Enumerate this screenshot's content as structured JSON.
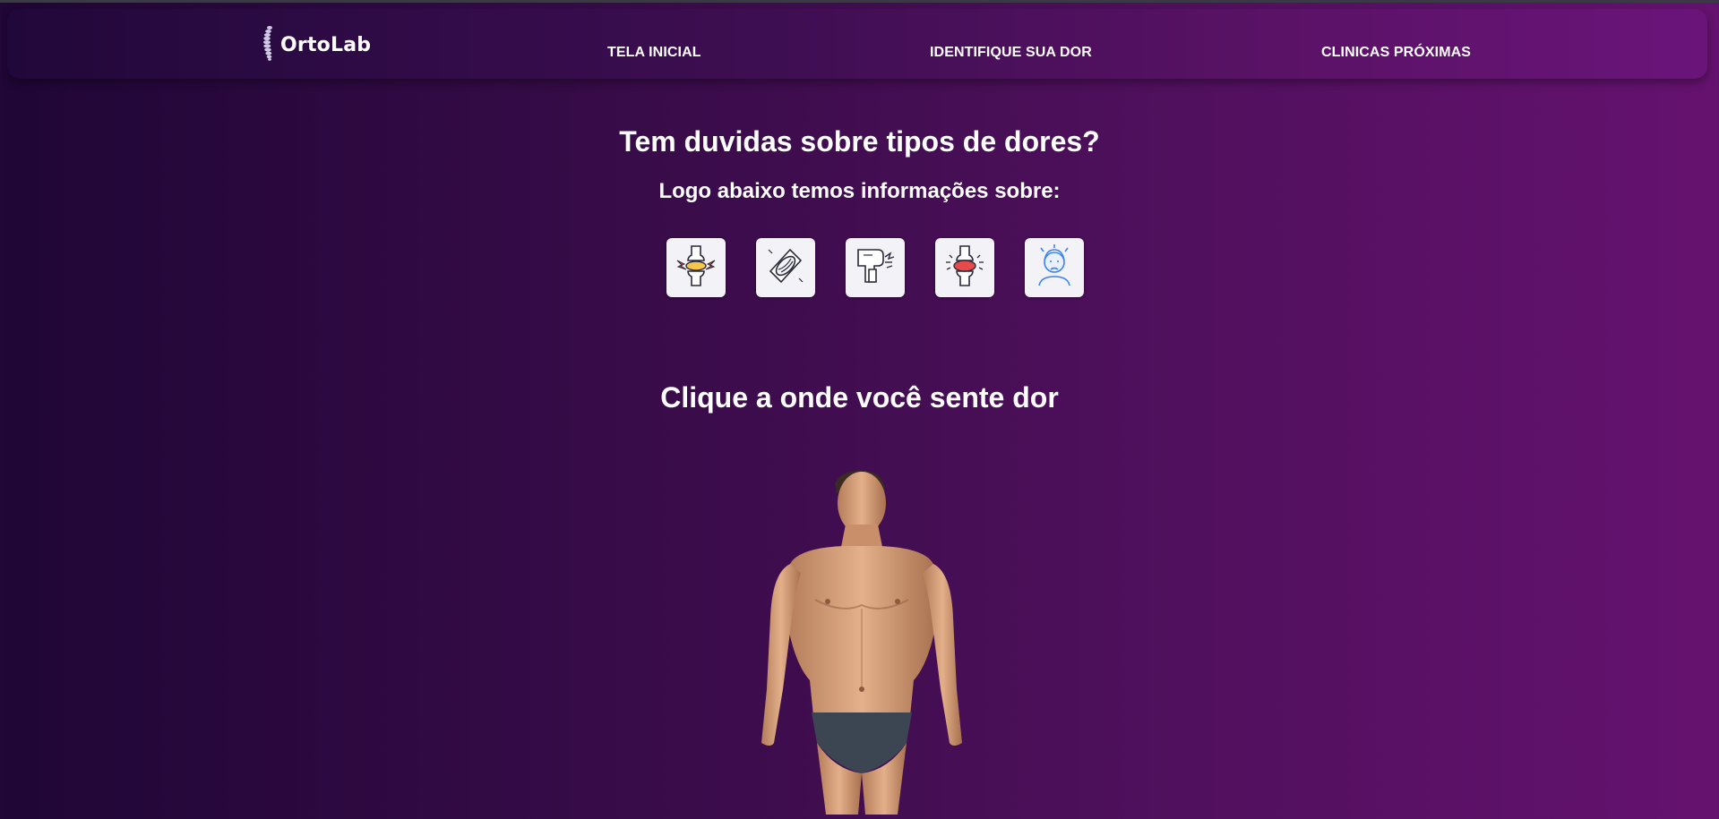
{
  "brand": {
    "name": "OrtoLab",
    "icon": "spine-icon"
  },
  "nav": {
    "items": [
      {
        "label": "TELA INICIAL"
      },
      {
        "label": "IDENTIFIQUE SUA DOR"
      },
      {
        "label": "CLINICAS PRÓXIMAS"
      }
    ]
  },
  "main": {
    "heading": "Tem duvidas sobre tipos de dores?",
    "subheading": "Logo abaixo temos informações sobre:",
    "pain_type_icons": [
      "joint-pain-icon",
      "muscle-pain-icon",
      "bone-fracture-icon",
      "knee-inflammation-icon",
      "headache-icon"
    ],
    "click_heading": "Clique a onde você sente dor",
    "body_map": "human-body-front"
  },
  "colors": {
    "background_left": "#1f0636",
    "background_right": "#65126f",
    "card_background": "#f3f2f6",
    "pain_red": "#e64a4a",
    "icon_blue": "#3b82f6"
  }
}
